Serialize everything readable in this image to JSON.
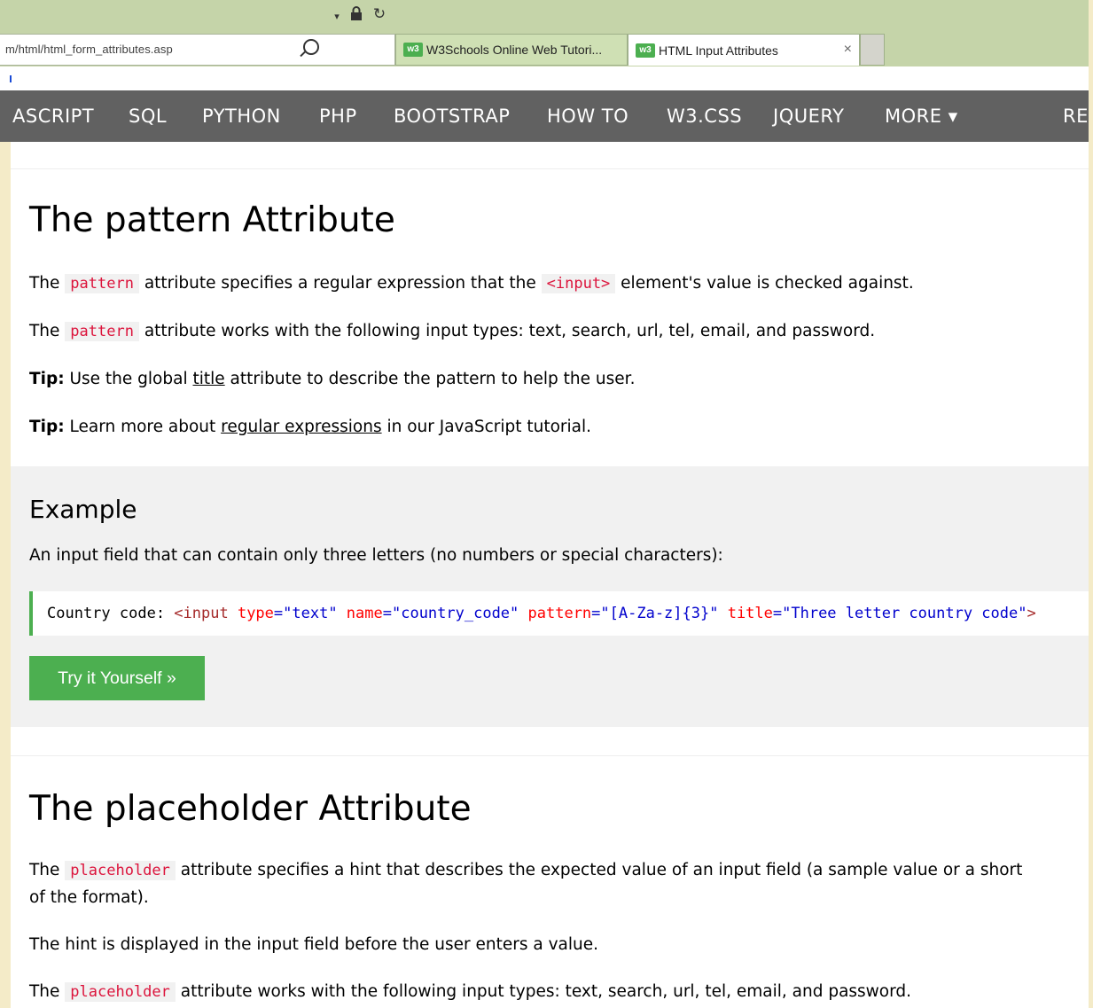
{
  "browser": {
    "address": "m/html/html_form_attributes.asp",
    "tabs": [
      {
        "label": "W3Schools Online Web Tutori..."
      },
      {
        "label": "HTML Input Attributes",
        "close": "×"
      }
    ]
  },
  "nav": {
    "items": [
      "ASCRIPT",
      "SQL",
      "PYTHON",
      "PHP",
      "BOOTSTRAP",
      "HOW TO",
      "W3.CSS",
      "JQUERY",
      "MORE ▾",
      "RE"
    ]
  },
  "pattern_section": {
    "title": "The pattern Attribute",
    "p1": {
      "pre": "The ",
      "code": "pattern",
      "mid": " attribute specifies a regular expression that the ",
      "code2": "<input>",
      "post": " element's value is checked against."
    },
    "p2": {
      "pre": "The ",
      "code": "pattern",
      "post": " attribute works with the following input types: text, search, url, tel, email, and password."
    },
    "tip1": {
      "label": "Tip:",
      "pre": " Use the global ",
      "link": "title",
      "post": " attribute to describe the pattern to help the user."
    },
    "tip2": {
      "label": "Tip:",
      "pre": " Learn more about ",
      "link": "regular expressions",
      "post": " in our JavaScript tutorial."
    }
  },
  "example": {
    "title": "Example",
    "description": "An input field that can contain only three letters (no numbers or special characters):",
    "code": {
      "text": "Country code: ",
      "tag_open": "<input",
      "a1": " type",
      "v1": "=\"text\"",
      "a2": " name",
      "v2": "=\"country_code\"",
      "a3": " pattern",
      "v3": "=\"[A-Za-z]{3}\"",
      "a4": " title",
      "v4": "=\"Three letter country code\"",
      "tag_close": ">"
    },
    "button": "Try it Yourself »"
  },
  "placeholder_section": {
    "title": "The placeholder Attribute",
    "p1a": {
      "pre": "The ",
      "code": "placeholder",
      "post": " attribute specifies a hint that describes the expected value of an input field (a sample value or a short"
    },
    "p1b": "of the format).",
    "p2": "The hint is displayed in the input field before the user enters a value.",
    "p3": {
      "pre": "The ",
      "code": "placeholder",
      "post": " attribute works with the following input types: text, search, url, tel, email, and password."
    }
  },
  "colors": {
    "nav_bg": "#616161",
    "accent": "#4caf50",
    "code_red": "#dc143c",
    "example_bg": "#f1f1f1"
  }
}
